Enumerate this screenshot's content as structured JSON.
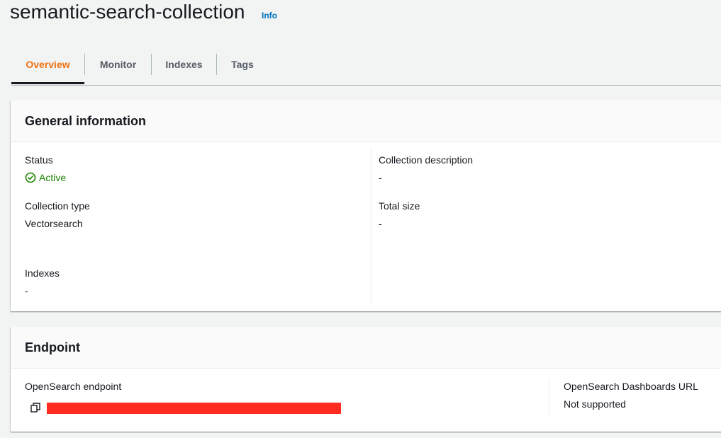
{
  "header": {
    "title": "semantic-search-collection",
    "info_label": "Info"
  },
  "tabs": [
    {
      "label": "Overview",
      "active": true
    },
    {
      "label": "Monitor",
      "active": false
    },
    {
      "label": "Indexes",
      "active": false
    },
    {
      "label": "Tags",
      "active": false
    }
  ],
  "general": {
    "heading": "General information",
    "status_label": "Status",
    "status_value": "Active",
    "description_label": "Collection description",
    "description_value": "-",
    "type_label": "Collection type",
    "type_value": "Vectorsearch",
    "size_label": "Total size",
    "size_value": "-",
    "indexes_label": "Indexes",
    "indexes_value": "-"
  },
  "endpoint": {
    "heading": "Endpoint",
    "opensearch_label": "OpenSearch endpoint",
    "dashboards_label": "OpenSearch Dashboards URL",
    "dashboards_value": "Not supported"
  },
  "colors": {
    "accent": "#ec7211",
    "link": "#0073bb",
    "success": "#1d8102",
    "redaction": "#ff2a20"
  }
}
